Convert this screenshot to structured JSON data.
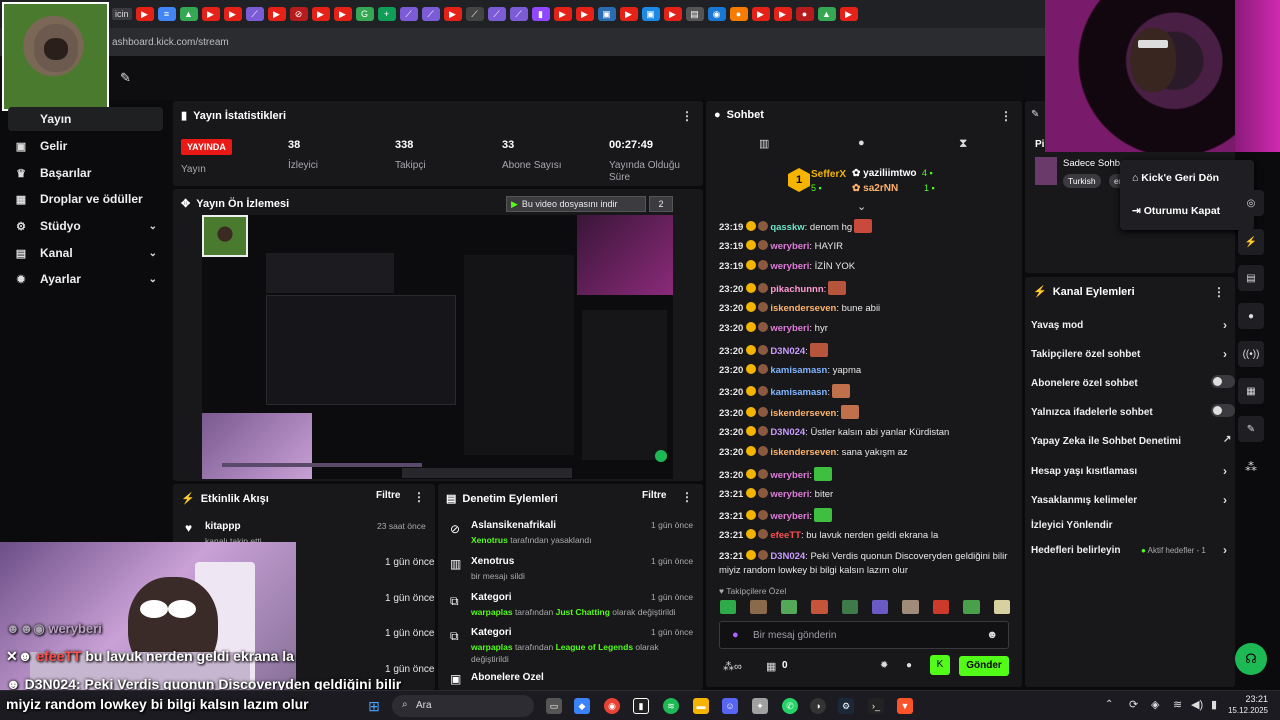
{
  "browser": {
    "url": "ashboard.kick.com/stream",
    "tab_label": "icin"
  },
  "sidebar": {
    "items": [
      {
        "label": "Yayın"
      },
      {
        "label": "Gelir"
      },
      {
        "label": "Başarılar"
      },
      {
        "label": "Droplar ve ödüller"
      },
      {
        "label": "Stüdyo"
      },
      {
        "label": "Kanal"
      },
      {
        "label": "Ayarlar"
      }
    ]
  },
  "stats": {
    "title": "Yayın İstatistikleri",
    "live_badge": "YAYINDA",
    "live_label": "Yayın",
    "items": [
      {
        "value": "38",
        "label": "İzleyici"
      },
      {
        "value": "338",
        "label": "Takipçi"
      },
      {
        "value": "33",
        "label": "Abone Sayısı"
      },
      {
        "value": "00:27:49",
        "label": "Yayında Olduğu Süre"
      }
    ]
  },
  "preview": {
    "title": "Yayın Ön İzlemesi",
    "download_banner": "Bu video dosyasını indir",
    "download_count": "2"
  },
  "activity": {
    "title": "Etkinlik Akışı",
    "filter": "Filtre",
    "events": [
      {
        "name": "kitappp",
        "sub": "kanalı takip etti",
        "time": "23 saat önce"
      },
      {
        "name": "",
        "sub": "",
        "time": "1 gün önce"
      },
      {
        "name": "",
        "sub": "",
        "time": "1 gün önce"
      },
      {
        "name": "",
        "sub": "",
        "time": "1 gün önce"
      },
      {
        "name": "",
        "sub": "",
        "time": "1 gün önce"
      },
      {
        "name": "",
        "sub": "",
        "time": "1 gün önce"
      }
    ]
  },
  "moderation": {
    "title": "Denetim Eylemleri",
    "filter": "Filtre",
    "events": [
      {
        "name": "Aslansikenafrikali",
        "actor": "Xenotrus",
        "rest": " tarafından yasaklandı",
        "time": "1 gün önce"
      },
      {
        "name": "Xenotrus",
        "sub": "bir mesajı sildi",
        "time": "1 gün önce"
      },
      {
        "name": "Kategori",
        "actor": "warpaplas",
        "mid": " tarafından ",
        "cat": "Just Chatting",
        "rest": " olarak değiştirildi",
        "time": "1 gün önce"
      },
      {
        "name": "Kategori",
        "actor": "warpaplas",
        "mid": " tarafından ",
        "cat": "League of Legends",
        "rest": " olarak",
        "rest2": "değiştirildi",
        "time": "1 gün önce"
      },
      {
        "name": "Abonelere Özel",
        "time": ""
      }
    ]
  },
  "chat": {
    "title": "Sohbet",
    "top_gifters": [
      {
        "name": "SefferX",
        "count": "5"
      },
      {
        "name": "yaziliimtwo",
        "count": "4"
      },
      {
        "name": "sa2rNN",
        "count": "1"
      }
    ],
    "messages": [
      {
        "time": "23:19",
        "user": "qasskw",
        "text": ": denom hg",
        "color": "#6be3c6"
      },
      {
        "time": "23:19",
        "user": "weryberi",
        "text": ": HAYIR",
        "color": "#e07ad9"
      },
      {
        "time": "23:19",
        "user": "weryberi",
        "text": ": İZİN YOK",
        "color": "#e07ad9"
      },
      {
        "time": "23:20",
        "user": "pikachunnn",
        "text": ":",
        "color": "#ff9ad2"
      },
      {
        "time": "23:20",
        "user": "iskenderseven",
        "text": ": bune abii",
        "color": "#ffb36b"
      },
      {
        "time": "23:20",
        "user": "weryberi",
        "text": ": hyr",
        "color": "#e07ad9"
      },
      {
        "time": "23:20",
        "user": "D3N024",
        "text": ":",
        "color": "#c99cff"
      },
      {
        "time": "23:20",
        "user": "kamisamasn",
        "text": ": yapma",
        "color": "#7fb5ff"
      },
      {
        "time": "23:20",
        "user": "kamisamasn",
        "text": ":",
        "color": "#7fb5ff"
      },
      {
        "time": "23:20",
        "user": "iskenderseven",
        "text": ":",
        "color": "#ffb36b"
      },
      {
        "time": "23:20",
        "user": "D3N024",
        "text": ": Üstler kalsın abi yanlar Kürdistan",
        "color": "#c99cff"
      },
      {
        "time": "23:20",
        "user": "iskenderseven",
        "text": ": sana yakışm az",
        "color": "#ffb36b"
      },
      {
        "time": "23:20",
        "user": "weryberi",
        "text": ":",
        "color": "#e07ad9"
      },
      {
        "time": "23:21",
        "user": "weryberi",
        "text": ": biter",
        "color": "#e07ad9"
      },
      {
        "time": "23:21",
        "user": "weryberi",
        "text": ":",
        "color": "#e07ad9"
      },
      {
        "time": "23:21",
        "user": "efeeTT",
        "text": ": bu lavuk nerden geldi ekrana la",
        "color": "#ff4e4e"
      },
      {
        "time": "23:21",
        "user": "D3N024",
        "text": ": Peki Verdis quonun Discoveryden geldiğini bilir",
        "text2": "miyiz random lowkey bi bilgi kalsın lazım olur",
        "color": "#c99cff"
      }
    ],
    "followers_only": "Takipçilere Özel",
    "input_placeholder": "Bir mesaj gönderin",
    "points": "0",
    "send": "Gönder"
  },
  "actions": {
    "title": "Kanal Eylemleri",
    "rows": [
      {
        "label": "Yavaş mod"
      },
      {
        "label": "Takipçilere özel sohbet"
      },
      {
        "label": "Abonelere özel sohbet"
      },
      {
        "label": "Yalnızca ifadelerle sohbet"
      },
      {
        "label": "Yapay Zeka ile Sohbet Denetimi"
      },
      {
        "label": "Hesap yaşı kısıtlaması"
      },
      {
        "label": "Yasaklanmış kelimeler"
      },
      {
        "label": "İzleyici Yönlendir"
      },
      {
        "label": "Hedefleri belirleyin",
        "extra": "Aktif hedefler - 1"
      }
    ]
  },
  "pinned": {
    "label": "Pi",
    "name": "Sadece Sohb",
    "tag": "Turkish",
    "tag2": "en"
  },
  "popup": {
    "back": "Kick'e Geri Dön",
    "logout": "Oturumu Kapat"
  },
  "overlay": {
    "lines": [
      {
        "user": "weryberi",
        "text": ""
      },
      {
        "user": "efeeTT",
        "text": " bu lavuk nerden geldi ekrana la"
      },
      {
        "user": "D3N024",
        "text": ": Peki Verdis quonun Discoveryden geldiğini bilir"
      },
      {
        "user": "",
        "text": "miyiz random lowkey bi bilgi kalsın lazım olur"
      }
    ]
  },
  "taskbar": {
    "search": "Ara",
    "time": "23:21",
    "date": "15.12.2025"
  },
  "colors": {
    "kick_green": "#53fc18",
    "live_red": "#e91916",
    "panel": "#18181b"
  }
}
